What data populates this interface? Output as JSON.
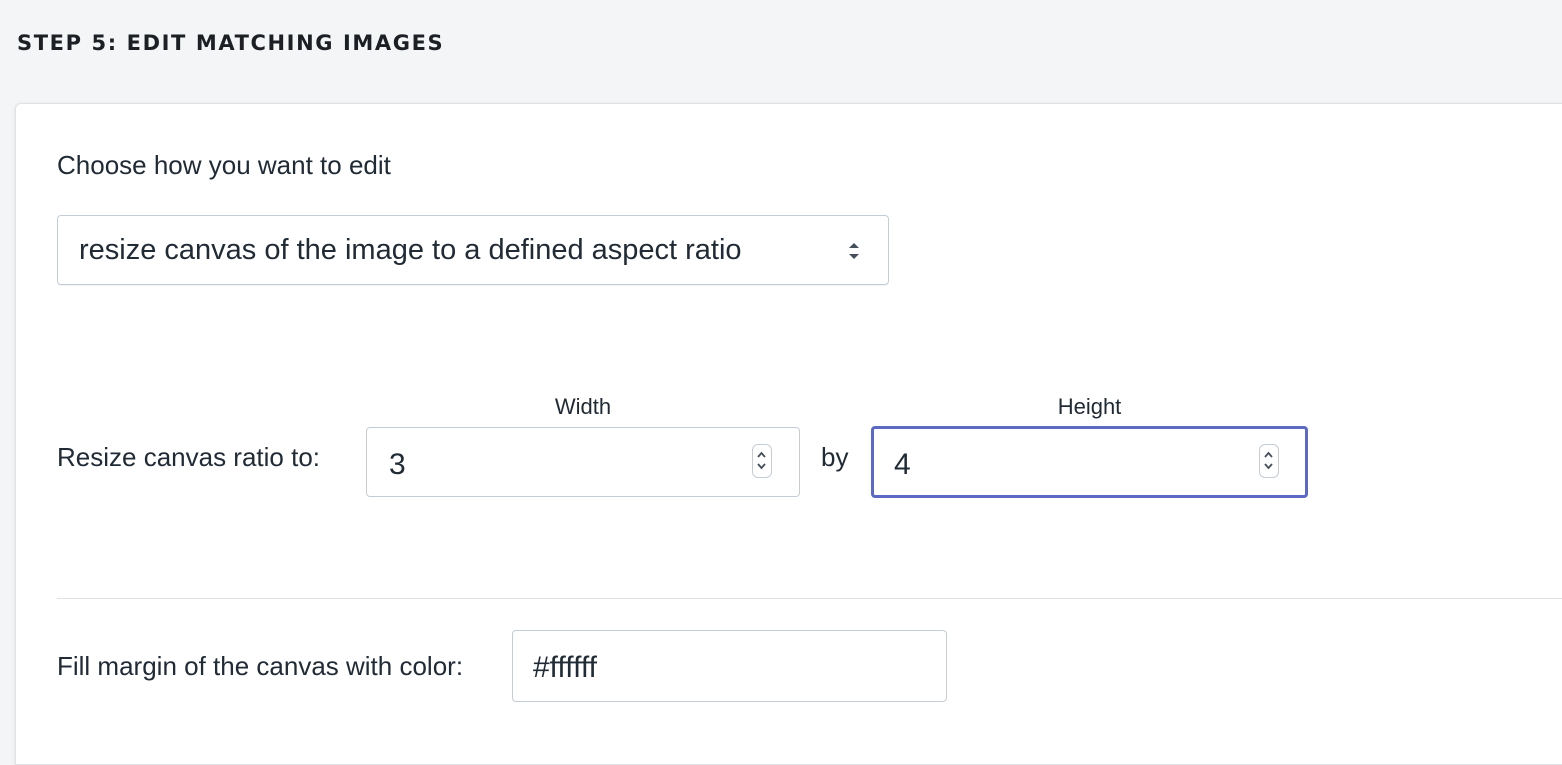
{
  "step": {
    "title": "STEP 5: EDIT MATCHING IMAGES"
  },
  "edit_mode": {
    "label": "Choose how you want to edit",
    "selected": "resize canvas of the image to a defined aspect ratio"
  },
  "ratio": {
    "label": "Resize canvas ratio to:",
    "width_label": "Width",
    "width_value": "3",
    "by_label": "by",
    "height_label": "Height",
    "height_value": "4"
  },
  "fill": {
    "label": "Fill margin of the canvas with color:",
    "value": "#ffffff"
  },
  "colors": {
    "accent_focus": "#5c6ac4",
    "border": "#c4cdd5",
    "text": "#212b36",
    "background": "#f4f5f7"
  },
  "icons": {
    "select": "up-down-chevron-icon",
    "number_spinner": "stepper-chevron-icon"
  }
}
